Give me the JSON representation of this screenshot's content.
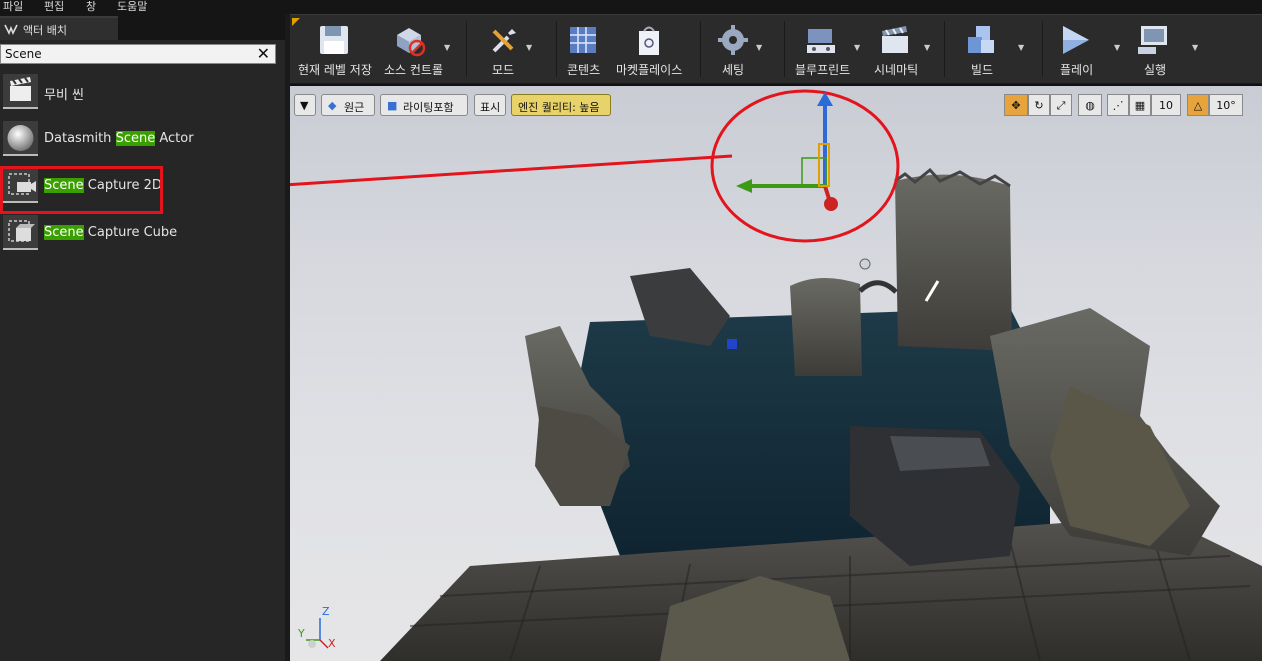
{
  "menu": [
    "파일",
    "편집",
    "창",
    "도움말"
  ],
  "panel": {
    "tab_title": "액터 배치",
    "search_value": "Scene",
    "clear_icon": "close-icon",
    "items": [
      {
        "pre": "무비 씬",
        "hl": "",
        "post": "",
        "icon": "clapperboard-icon"
      },
      {
        "pre": "Datasmith ",
        "hl": "Scene",
        "post": " Actor",
        "icon": "sphere-icon"
      },
      {
        "pre": "",
        "hl": "Scene",
        "post": " Capture 2D",
        "icon": "scene-capture-icon"
      },
      {
        "pre": "",
        "hl": "Scene",
        "post": " Capture Cube",
        "icon": "scene-capture-cube-icon"
      }
    ]
  },
  "toolbar": [
    {
      "label": "현재 레벨 저장",
      "icon": "floppy-disk-icon",
      "dropdown": false
    },
    {
      "label": "소스 컨트롤",
      "icon": "source-control-icon",
      "dropdown": true
    },
    {
      "label": "모드",
      "icon": "tools-icon",
      "dropdown": true
    },
    {
      "label": "콘텐츠",
      "icon": "grid-content-icon",
      "dropdown": false
    },
    {
      "label": "마켓플레이스",
      "icon": "shopping-bag-icon",
      "dropdown": false
    },
    {
      "label": "세팅",
      "icon": "gear-icon",
      "dropdown": true
    },
    {
      "label": "블루프린트",
      "icon": "gamepad-icon",
      "dropdown": true
    },
    {
      "label": "시네마틱",
      "icon": "clapperboard-icon",
      "dropdown": true
    },
    {
      "label": "빌드",
      "icon": "cubes-icon",
      "dropdown": true
    },
    {
      "label": "플레이",
      "icon": "play-icon",
      "dropdown": true
    },
    {
      "label": "실행",
      "icon": "monitor-gamepad-icon",
      "dropdown": true
    }
  ],
  "viewport": {
    "perspective": "원근",
    "lighting": "라이팅포함",
    "show": "표시",
    "quality": "엔진 퀄리티: 높음",
    "grid_snap": "10",
    "rotation_snap": "10°",
    "axis": {
      "z": "Z",
      "x": "X",
      "y": "Y"
    }
  },
  "colors": {
    "highlight": "#3aa000",
    "annotation": "#e3141c",
    "active_toggle": "#e7a33c",
    "quality_badge": "#e8d36a"
  }
}
